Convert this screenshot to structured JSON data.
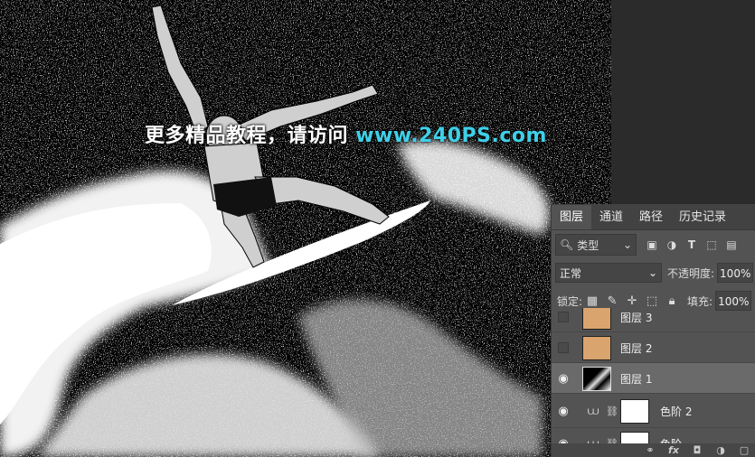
{
  "watermark": {
    "cn": "更多精品教程，请访问 ",
    "url": "www.240PS.com"
  },
  "panel": {
    "tabs": [
      "图层",
      "通道",
      "路径",
      "历史记录"
    ],
    "filter": {
      "label": "类型",
      "icons": [
        "image-filter-icon",
        "adjustment-filter-icon",
        "type-filter-icon",
        "shape-filter-icon",
        "smart-object-filter-icon"
      ]
    },
    "blend": {
      "mode": "正常",
      "opacity_label": "不透明度:",
      "opacity_value": "100%"
    },
    "lock": {
      "label": "锁定:",
      "fill_label": "填充:",
      "fill_value": "100%"
    },
    "layers": [
      {
        "name": "图层 3",
        "visible": false,
        "thumb_color": "#d9a46d"
      },
      {
        "name": "图层 2",
        "visible": false,
        "thumb_color": "#d9a46d"
      },
      {
        "name": "图层 1",
        "visible": true,
        "selected": true
      },
      {
        "name": "色阶 2",
        "visible": true,
        "adjustment": true
      },
      {
        "name": "色阶",
        "visible": true,
        "adjustment": true
      }
    ],
    "bottom_icons": [
      "link-icon",
      "fx-icon",
      "mask-icon",
      "adjustment-icon",
      "folder-icon"
    ],
    "bottom_fx": "fx"
  },
  "colors": {
    "accent_url": "#3fd0e8",
    "panel_bg": "#535353",
    "selected_row": "#6a6a6a"
  }
}
